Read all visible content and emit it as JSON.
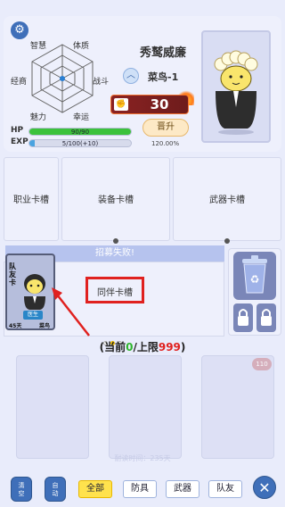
{
  "colors": {
    "background": "#e9ecfb",
    "accent_blue": "#3f6fb9",
    "hp_green": "#3cc23c",
    "exp_blue": "#4aa3e0",
    "highlight_red": "#e0211f",
    "power_red": "#8a2222",
    "active_yellow": "#ffe24d"
  },
  "header": {
    "settings_icon": "gear-icon",
    "stats": {
      "wisdom": "智慧",
      "physique": "体质",
      "diplomacy": "经商",
      "combat": "战斗",
      "charm": "魅力",
      "luck": "幸运"
    },
    "character_name": "秀鹫威廉",
    "rank": "菜鸟-1",
    "power": "30",
    "promote_label": "晋升",
    "hp_label": "HP",
    "hp_text": "90/90",
    "hp_ratio": 1.0,
    "exp_label": "EXP",
    "exp_text": "5/100(+10)",
    "exp_ratio": 0.05,
    "progress_percent": "120.00%"
  },
  "equipment_slots": [
    {
      "label": "职业卡槽"
    },
    {
      "label": "装备卡槽"
    },
    {
      "label": "武器卡槽"
    }
  ],
  "recruit": {
    "banner": "招募失败!",
    "companion_slot_label": "同伴卡槽",
    "card": {
      "side_text": "队友卡",
      "role": "医生",
      "age": "45天",
      "rank": "菜鸟"
    }
  },
  "count_line": {
    "prefix": "(当前",
    "current": "0",
    "separator": "/上限",
    "max": "999",
    "suffix": ")"
  },
  "bag": {
    "timer_text": "耐读时间：235天",
    "badge_value": "110"
  },
  "bottom_bar": {
    "clear_label": "清空",
    "auto_label": "自动",
    "filters": [
      {
        "label": "全部",
        "active": true
      },
      {
        "label": "防具",
        "active": false
      },
      {
        "label": "武器",
        "active": false
      },
      {
        "label": "队友",
        "active": false
      }
    ],
    "close_icon": "close-icon"
  }
}
